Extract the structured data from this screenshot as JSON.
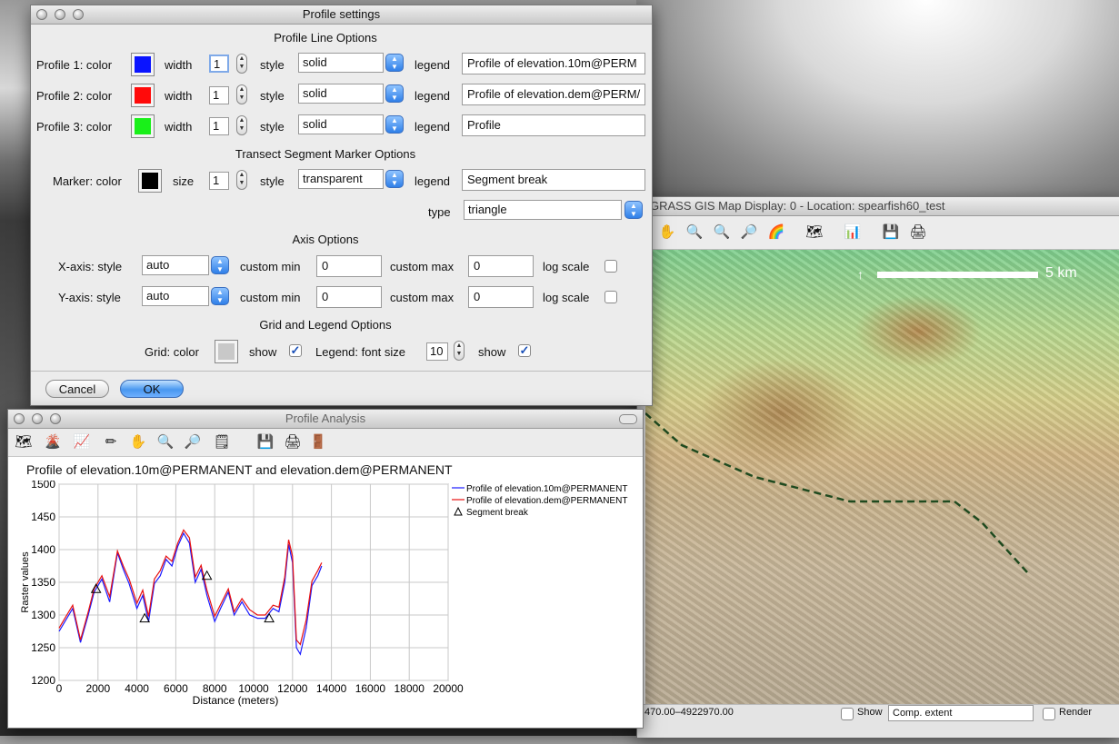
{
  "settings": {
    "title": "Profile settings",
    "line_section": "Profile Line Options",
    "profiles": [
      {
        "label": "Profile 1: color",
        "color": "#0a14ff",
        "width_label": "width",
        "width": "1",
        "style_label": "style",
        "style": "solid",
        "legend_label": "legend",
        "legend": "Profile of elevation.10m@PERM"
      },
      {
        "label": "Profile 2: color",
        "color": "#ff0a0a",
        "width_label": "width",
        "width": "1",
        "style_label": "style",
        "style": "solid",
        "legend_label": "legend",
        "legend": "Profile of elevation.dem@PERM/"
      },
      {
        "label": "Profile 3: color",
        "color": "#19f019",
        "width_label": "width",
        "width": "1",
        "style_label": "style",
        "style": "solid",
        "legend_label": "legend",
        "legend": "Profile"
      }
    ],
    "marker_section": "Transect Segment Marker Options",
    "marker": {
      "label": "Marker: color",
      "color": "#000000",
      "size_label": "size",
      "size": "1",
      "style_label": "style",
      "style": "transparent",
      "legend_label": "legend",
      "legend": "Segment break",
      "type_label": "type",
      "type": "triangle"
    },
    "axis_section": "Axis Options",
    "axes": [
      {
        "label": "X-axis: style",
        "style": "auto",
        "min_label": "custom min",
        "min": "0",
        "max_label": "custom max",
        "max": "0",
        "log_label": "log scale"
      },
      {
        "label": "Y-axis: style",
        "style": "auto",
        "min_label": "custom min",
        "min": "0",
        "max_label": "custom max",
        "max": "0",
        "log_label": "log scale"
      }
    ],
    "grid_section": "Grid and Legend Options",
    "grid": {
      "label": "Grid: color",
      "color": "#c8c8c8",
      "show_label": "show",
      "legend_font_label": "Legend: font size",
      "font_size": "10",
      "legend_show_label": "show"
    },
    "cancel": "Cancel",
    "ok": "OK"
  },
  "analysis": {
    "title": "Profile Analysis",
    "icons": [
      "raster-icon",
      "raster-multi-icon",
      "profile-icon",
      "draw-transect-icon",
      "pan-icon",
      "zoom-in-icon",
      "zoom-out-icon",
      "settings-icon",
      "save-icon",
      "print-icon",
      "exit-icon"
    ]
  },
  "mapdisplay": {
    "title": "GRASS GIS Map Display: 0 - Location: spearfish60_test",
    "scale_label": "5 km",
    "coords": "470.00–4922970.00",
    "show_label": "Show",
    "extent_combo": "Comp. extent",
    "render_label": "Render"
  },
  "chart_data": {
    "type": "line",
    "title": "Profile of elevation.10m@PERMANENT and elevation.dem@PERMANENT",
    "xlabel": "Distance (meters)",
    "ylabel": "Raster values",
    "xlim": [
      0,
      20000
    ],
    "ylim": [
      1200,
      1500
    ],
    "xticks": [
      "0",
      "2000",
      "4000",
      "6000",
      "8000",
      "10000",
      "12000",
      "14000",
      "16000",
      "18000",
      "20000"
    ],
    "yticks": [
      "1200",
      "1250",
      "1300",
      "1350",
      "1400",
      "1450",
      "1500"
    ],
    "grid": true,
    "legend_position": "top-right",
    "series": [
      {
        "name": "Profile of elevation.10m@PERMANENT",
        "color": "#1a1aff",
        "x": [
          0,
          300,
          700,
          1100,
          1500,
          1800,
          2200,
          2600,
          3000,
          3300,
          3600,
          4000,
          4300,
          4600,
          4900,
          5200,
          5500,
          5800,
          6100,
          6400,
          6700,
          7000,
          7300,
          7600,
          8000,
          8300,
          8700,
          9000,
          9400,
          9800,
          10200,
          10600,
          11000,
          11300,
          11600,
          11800,
          12000,
          12200,
          12400,
          12700,
          13000,
          13300,
          13500
        ],
        "y": [
          1275,
          1290,
          1310,
          1258,
          1300,
          1335,
          1355,
          1320,
          1395,
          1370,
          1348,
          1310,
          1330,
          1290,
          1348,
          1360,
          1385,
          1375,
          1405,
          1425,
          1410,
          1350,
          1370,
          1330,
          1290,
          1310,
          1335,
          1300,
          1320,
          1300,
          1295,
          1295,
          1310,
          1305,
          1350,
          1408,
          1380,
          1250,
          1240,
          1280,
          1345,
          1360,
          1375
        ]
      },
      {
        "name": "Profile of elevation.dem@PERMANENT",
        "color": "#e81010",
        "x": [
          0,
          300,
          700,
          1100,
          1500,
          1800,
          2200,
          2600,
          3000,
          3300,
          3600,
          4000,
          4300,
          4600,
          4900,
          5200,
          5500,
          5800,
          6100,
          6400,
          6700,
          7000,
          7300,
          7600,
          8000,
          8300,
          8700,
          9000,
          9400,
          9800,
          10200,
          10600,
          11000,
          11300,
          11600,
          11800,
          12000,
          12200,
          12400,
          12700,
          13000,
          13300,
          13500
        ],
        "y": [
          1280,
          1295,
          1315,
          1262,
          1305,
          1340,
          1360,
          1328,
          1398,
          1375,
          1355,
          1318,
          1338,
          1298,
          1355,
          1368,
          1390,
          1382,
          1410,
          1430,
          1418,
          1358,
          1376,
          1338,
          1298,
          1316,
          1340,
          1305,
          1325,
          1308,
          1300,
          1300,
          1315,
          1312,
          1358,
          1415,
          1390,
          1262,
          1255,
          1292,
          1352,
          1368,
          1380
        ]
      }
    ],
    "markers": {
      "name": "Segment break",
      "x": [
        1900,
        4400,
        7600,
        10800
      ],
      "y": [
        1340,
        1295,
        1360,
        1295
      ]
    }
  }
}
